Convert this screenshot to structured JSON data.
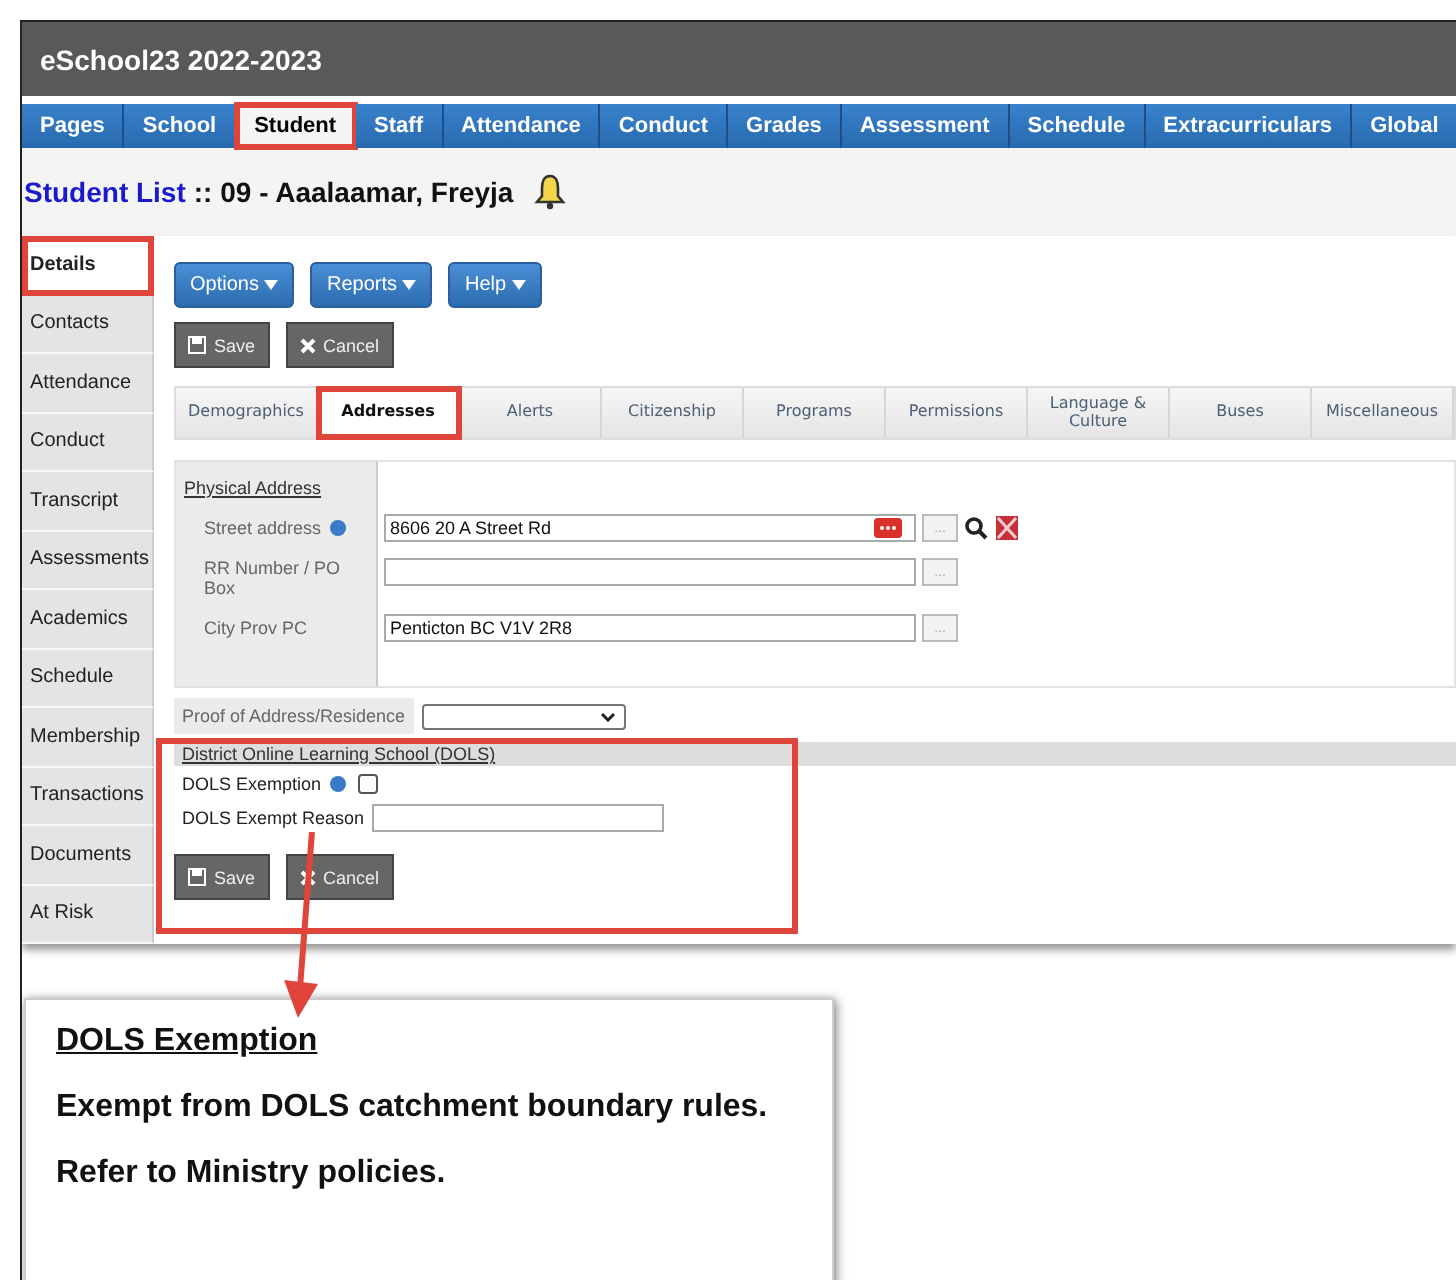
{
  "app_title": "eSchool23 2022-2023",
  "nav": [
    {
      "label": "Pages",
      "selected": false,
      "highlighted": false
    },
    {
      "label": "School",
      "selected": false,
      "highlighted": false
    },
    {
      "label": "Student",
      "selected": true,
      "highlighted": true
    },
    {
      "label": "Staff",
      "selected": false,
      "highlighted": false
    },
    {
      "label": "Attendance",
      "selected": false,
      "highlighted": false
    },
    {
      "label": "Conduct",
      "selected": false,
      "highlighted": false
    },
    {
      "label": "Grades",
      "selected": false,
      "highlighted": false
    },
    {
      "label": "Assessment",
      "selected": false,
      "highlighted": false
    },
    {
      "label": "Schedule",
      "selected": false,
      "highlighted": false
    },
    {
      "label": "Extracurriculars",
      "selected": false,
      "highlighted": false
    },
    {
      "label": "Global",
      "selected": false,
      "highlighted": false
    }
  ],
  "page_title": {
    "link": "Student List",
    "rest": ":: 09 - Aaalaamar, Freyja"
  },
  "sidebar": [
    {
      "label": "Details",
      "selected": true,
      "highlighted": true
    },
    {
      "label": "Contacts",
      "selected": false,
      "highlighted": false
    },
    {
      "label": "Attendance",
      "selected": false,
      "highlighted": false
    },
    {
      "label": "Conduct",
      "selected": false,
      "highlighted": false
    },
    {
      "label": "Transcript",
      "selected": false,
      "highlighted": false
    },
    {
      "label": "Assessments",
      "selected": false,
      "highlighted": false
    },
    {
      "label": "Academics",
      "selected": false,
      "highlighted": false
    },
    {
      "label": "Schedule",
      "selected": false,
      "highlighted": false
    },
    {
      "label": "Membership",
      "selected": false,
      "highlighted": false
    },
    {
      "label": "Transactions",
      "selected": false,
      "highlighted": false
    },
    {
      "label": "Documents",
      "selected": false,
      "highlighted": false
    },
    {
      "label": "At Risk",
      "selected": false,
      "highlighted": false
    }
  ],
  "menu_buttons": [
    "Options",
    "Reports",
    "Help"
  ],
  "action_buttons": [
    {
      "kind": "save",
      "label": "Save"
    },
    {
      "kind": "cancel",
      "label": "Cancel"
    }
  ],
  "subtabs": [
    {
      "label": "Demographics",
      "selected": false,
      "highlighted": false
    },
    {
      "label": "Addresses",
      "selected": true,
      "highlighted": true
    },
    {
      "label": "Alerts",
      "selected": false,
      "highlighted": false
    },
    {
      "label": "Citizenship",
      "selected": false,
      "highlighted": false
    },
    {
      "label": "Programs",
      "selected": false,
      "highlighted": false
    },
    {
      "label": "Permissions",
      "selected": false,
      "highlighted": false
    },
    {
      "label": "Language & Culture",
      "selected": false,
      "highlighted": false
    },
    {
      "label": "Buses",
      "selected": false,
      "highlighted": false
    },
    {
      "label": "Miscellaneous",
      "selected": false,
      "highlighted": false
    }
  ],
  "physical_address": {
    "heading": "Physical Address",
    "fields": [
      {
        "label": "Street address",
        "info": true,
        "value": "8606 20 A Street Rd",
        "lookup": "...",
        "tools": true
      },
      {
        "label": "RR Number / PO Box",
        "info": false,
        "lookup": "...",
        "tools": false
      },
      {
        "label": "City Prov PC",
        "info": false,
        "value": "Penticton BC  V1V 2R8",
        "lookup": "...",
        "tools": false
      }
    ]
  },
  "proof": {
    "label": "Proof of Address/Residence"
  },
  "dols": {
    "heading": "District Online Learning School (DOLS)",
    "highlighted": true,
    "exemption": {
      "label": "DOLS Exemption",
      "info": true,
      "checked": false
    },
    "reason": {
      "label": "DOLS Exempt Reason"
    },
    "buttons": [
      {
        "kind": "save",
        "label": "Save"
      },
      {
        "kind": "cancel",
        "label": "Cancel"
      }
    ]
  },
  "tooltip": {
    "title": "DOLS Exemption",
    "lines": [
      "Exempt from DOLS catchment boundary rules.",
      "Refer to Ministry policies."
    ]
  }
}
